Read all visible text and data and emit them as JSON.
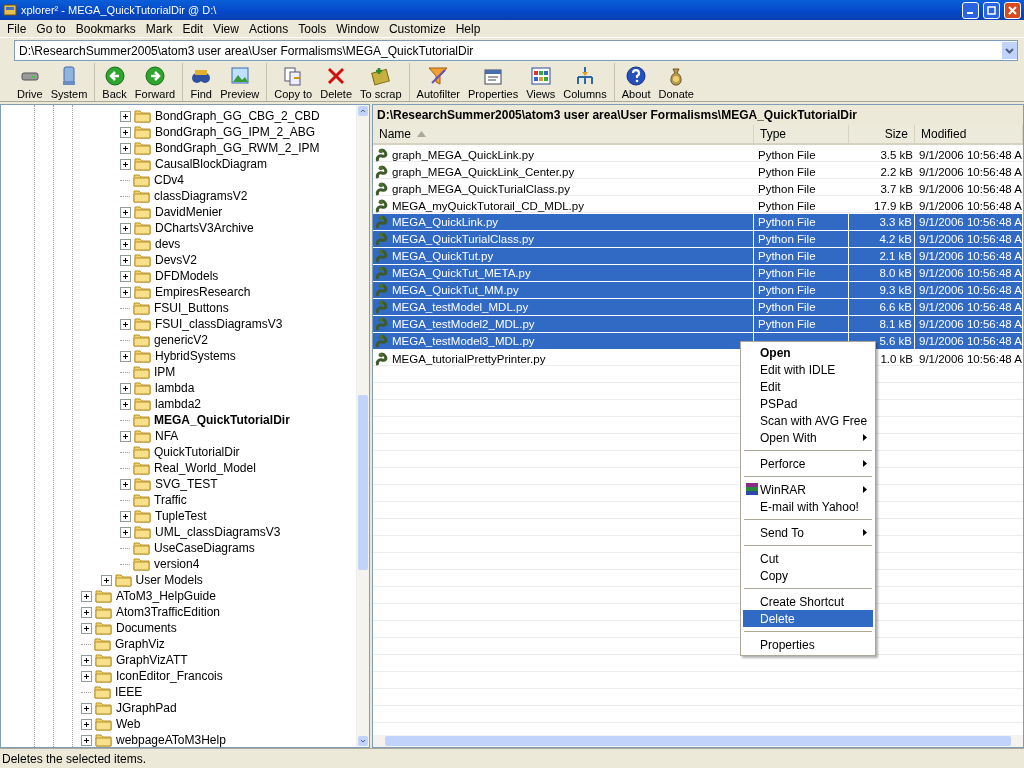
{
  "window": {
    "title": "xplorer² - MEGA_QuickTutorialDir @ D:\\"
  },
  "menu_bar": [
    "File",
    "Go to",
    "Bookmarks",
    "Mark",
    "Edit",
    "View",
    "Actions",
    "Tools",
    "Window",
    "Customize",
    "Help"
  ],
  "address": {
    "value": "D:\\ResearchSummer2005\\atom3 user area\\User Formalisms\\MEGA_QuickTutorialDir"
  },
  "toolbar": {
    "groups": [
      [
        {
          "label": "Drive",
          "kind": "drive"
        },
        {
          "label": "System",
          "kind": "system"
        }
      ],
      [
        {
          "label": "Back",
          "kind": "back"
        },
        {
          "label": "Forward",
          "kind": "forward"
        }
      ],
      [
        {
          "label": "Find",
          "kind": "find"
        },
        {
          "label": "Preview",
          "kind": "preview"
        }
      ],
      [
        {
          "label": "Copy to",
          "kind": "copy"
        },
        {
          "label": "Delete",
          "kind": "delete"
        },
        {
          "label": "To scrap",
          "kind": "scrap"
        }
      ],
      [
        {
          "label": "Autofilter",
          "kind": "autofilter"
        },
        {
          "label": "Properties",
          "kind": "properties"
        },
        {
          "label": "Views",
          "kind": "views"
        },
        {
          "label": "Columns",
          "kind": "columns"
        }
      ],
      [
        {
          "label": "About",
          "kind": "about"
        },
        {
          "label": "Donate",
          "kind": "donate"
        }
      ]
    ]
  },
  "tree": {
    "items": [
      {
        "children": [
          {
            "children": [
              {
                "label": "BondGraph_GG_CBG_2_CBD",
                "expandable": true,
                "current": false
              },
              {
                "label": "BondGraph_GG_IPM_2_ABG",
                "expandable": true,
                "current": false
              },
              {
                "label": "BondGraph_GG_RWM_2_IPM",
                "expandable": true,
                "current": false
              },
              {
                "label": "CausalBlockDiagram",
                "expandable": true,
                "current": false
              },
              {
                "label": "CDv4",
                "expandable": false,
                "current": false
              },
              {
                "label": "classDiagramsV2",
                "expandable": false,
                "current": false
              },
              {
                "label": "DavidMenier",
                "expandable": true,
                "current": false
              },
              {
                "label": "DChartsV3Archive",
                "expandable": true,
                "current": false
              },
              {
                "label": "devs",
                "expandable": true,
                "current": false
              },
              {
                "label": "DevsV2",
                "expandable": true,
                "current": false
              },
              {
                "label": "DFDModels",
                "expandable": true,
                "current": false
              },
              {
                "label": "EmpiresResearch",
                "expandable": true,
                "current": false
              },
              {
                "label": "FSUI_Buttons",
                "expandable": false,
                "current": false
              },
              {
                "label": "FSUI_classDiagramsV3",
                "expandable": true,
                "current": false
              },
              {
                "label": "genericV2",
                "expandable": false,
                "current": false
              },
              {
                "label": "HybridSystems",
                "expandable": true,
                "current": false
              },
              {
                "label": "IPM",
                "expandable": false,
                "current": false
              },
              {
                "label": "lambda",
                "expandable": true,
                "current": false
              },
              {
                "label": "lambda2",
                "expandable": true,
                "current": false
              },
              {
                "label": "MEGA_QuickTutorialDir",
                "expandable": false,
                "current": true
              },
              {
                "label": "NFA",
                "expandable": true,
                "current": false
              },
              {
                "label": "QuickTutorialDir",
                "expandable": false,
                "current": false
              },
              {
                "label": "Real_World_Model",
                "expandable": false,
                "current": false
              },
              {
                "label": "SVG_TEST",
                "expandable": true,
                "current": false
              },
              {
                "label": "Traffic",
                "expandable": false,
                "current": false
              },
              {
                "label": "TupleTest",
                "expandable": true,
                "current": false
              },
              {
                "label": "UML_classDiagramsV3",
                "expandable": true,
                "current": false
              },
              {
                "label": "UseCaseDiagrams",
                "expandable": false,
                "current": false
              },
              {
                "label": "version4",
                "expandable": false,
                "current": false
              }
            ]
          },
          {
            "label": "User Models",
            "expandable": true,
            "current": false
          }
        ]
      },
      {
        "label": "AToM3_HelpGuide",
        "expandable": true,
        "current": false
      },
      {
        "label": "Atom3TrafficEdition",
        "expandable": true,
        "current": false
      },
      {
        "label": "Documents",
        "expandable": true,
        "current": false
      },
      {
        "label": "GraphViz",
        "expandable": false,
        "current": false
      },
      {
        "label": "GraphVizATT",
        "expandable": true,
        "current": false
      },
      {
        "label": "IconEditor_Francois",
        "expandable": true,
        "current": false
      },
      {
        "label": "IEEE",
        "expandable": false,
        "current": false
      },
      {
        "label": "JGraphPad",
        "expandable": true,
        "current": false
      },
      {
        "label": "Web",
        "expandable": true,
        "current": false
      },
      {
        "label": "webpageAToM3Help",
        "expandable": true,
        "current": false
      }
    ]
  },
  "file_list": {
    "path": "D:\\ResearchSummer2005\\atom3 user area\\User Formalisms\\MEGA_QuickTutorialDir",
    "columns": [
      "Name",
      "Type",
      "Size",
      "Modified"
    ],
    "rows": [
      {
        "name": "graph_MEGA_QuickLink.py",
        "type": "Python File",
        "size": "3.5 kB",
        "modified": "9/1/2006 10:56:48 A",
        "selected": false
      },
      {
        "name": "graph_MEGA_QuickLink_Center.py",
        "type": "Python File",
        "size": "2.2 kB",
        "modified": "9/1/2006 10:56:48 A",
        "selected": false
      },
      {
        "name": "graph_MEGA_QuickTurialClass.py",
        "type": "Python File",
        "size": "3.7 kB",
        "modified": "9/1/2006 10:56:48 A",
        "selected": false
      },
      {
        "name": "MEGA_myQuickTutorail_CD_MDL.py",
        "type": "Python File",
        "size": "17.9 kB",
        "modified": "9/1/2006 10:56:48 A",
        "selected": false
      },
      {
        "name": "MEGA_QuickLink.py",
        "type": "Python File",
        "size": "3.3 kB",
        "modified": "9/1/2006 10:56:48 A",
        "selected": true
      },
      {
        "name": "MEGA_QuickTurialClass.py",
        "type": "Python File",
        "size": "4.2 kB",
        "modified": "9/1/2006 10:56:48 A",
        "selected": true
      },
      {
        "name": "MEGA_QuickTut.py",
        "type": "Python File",
        "size": "2.1 kB",
        "modified": "9/1/2006 10:56:48 A",
        "selected": true
      },
      {
        "name": "MEGA_QuickTut_META.py",
        "type": "Python File",
        "size": "8.0 kB",
        "modified": "9/1/2006 10:56:48 A",
        "selected": true
      },
      {
        "name": "MEGA_QuickTut_MM.py",
        "type": "Python File",
        "size": "9.3 kB",
        "modified": "9/1/2006 10:56:48 A",
        "selected": true
      },
      {
        "name": "MEGA_testModel_MDL.py",
        "type": "Python File",
        "size": "6.6 kB",
        "modified": "9/1/2006 10:56:48 A",
        "selected": true
      },
      {
        "name": "MEGA_testModel2_MDL.py",
        "type": "Python File",
        "size": "8.1 kB",
        "modified": "9/1/2006 10:56:48 A",
        "selected": true
      },
      {
        "name": "MEGA_testModel3_MDL.py",
        "size": "5.6 kB",
        "modified": "9/1/2006 10:56:48 A",
        "selected": true
      },
      {
        "name": "MEGA_tutorialPrettyPrinter.py",
        "size": "1.0 kB",
        "modified": "9/1/2006 10:56:48 A",
        "selected": false
      }
    ]
  },
  "context_menu": {
    "groups": [
      [
        {
          "label": "Open",
          "default": true,
          "submenu": false,
          "icon": false,
          "selected": false
        },
        {
          "label": "Edit with IDLE",
          "default": false,
          "submenu": false,
          "icon": false,
          "selected": false
        },
        {
          "label": "Edit",
          "default": false,
          "submenu": false,
          "icon": false,
          "selected": false
        },
        {
          "label": "PSPad",
          "default": false,
          "submenu": false,
          "icon": false,
          "selected": false
        },
        {
          "label": "Scan with AVG Free",
          "default": false,
          "submenu": false,
          "icon": false,
          "selected": false
        },
        {
          "label": "Open With",
          "default": false,
          "submenu": true,
          "icon": false,
          "selected": false
        }
      ],
      [
        {
          "label": "Perforce",
          "default": false,
          "submenu": true,
          "icon": false,
          "selected": false
        }
      ],
      [
        {
          "label": "WinRAR",
          "default": false,
          "submenu": true,
          "icon": true,
          "selected": false
        },
        {
          "label": "E-mail with Yahoo!",
          "default": false,
          "submenu": false,
          "icon": false,
          "selected": false
        }
      ],
      [
        {
          "label": "Send To",
          "default": false,
          "submenu": true,
          "icon": false,
          "selected": false
        }
      ],
      [
        {
          "label": "Cut",
          "default": false,
          "submenu": false,
          "icon": false,
          "selected": false
        },
        {
          "label": "Copy",
          "default": false,
          "submenu": false,
          "icon": false,
          "selected": false
        }
      ],
      [
        {
          "label": "Create Shortcut",
          "default": false,
          "submenu": false,
          "icon": false,
          "selected": false
        },
        {
          "label": "Delete",
          "default": false,
          "submenu": false,
          "icon": false,
          "selected": true
        }
      ],
      [
        {
          "label": "Properties",
          "default": false,
          "submenu": false,
          "icon": false,
          "selected": false
        }
      ]
    ]
  },
  "status_bar": {
    "text": "Deletes the selected items."
  }
}
